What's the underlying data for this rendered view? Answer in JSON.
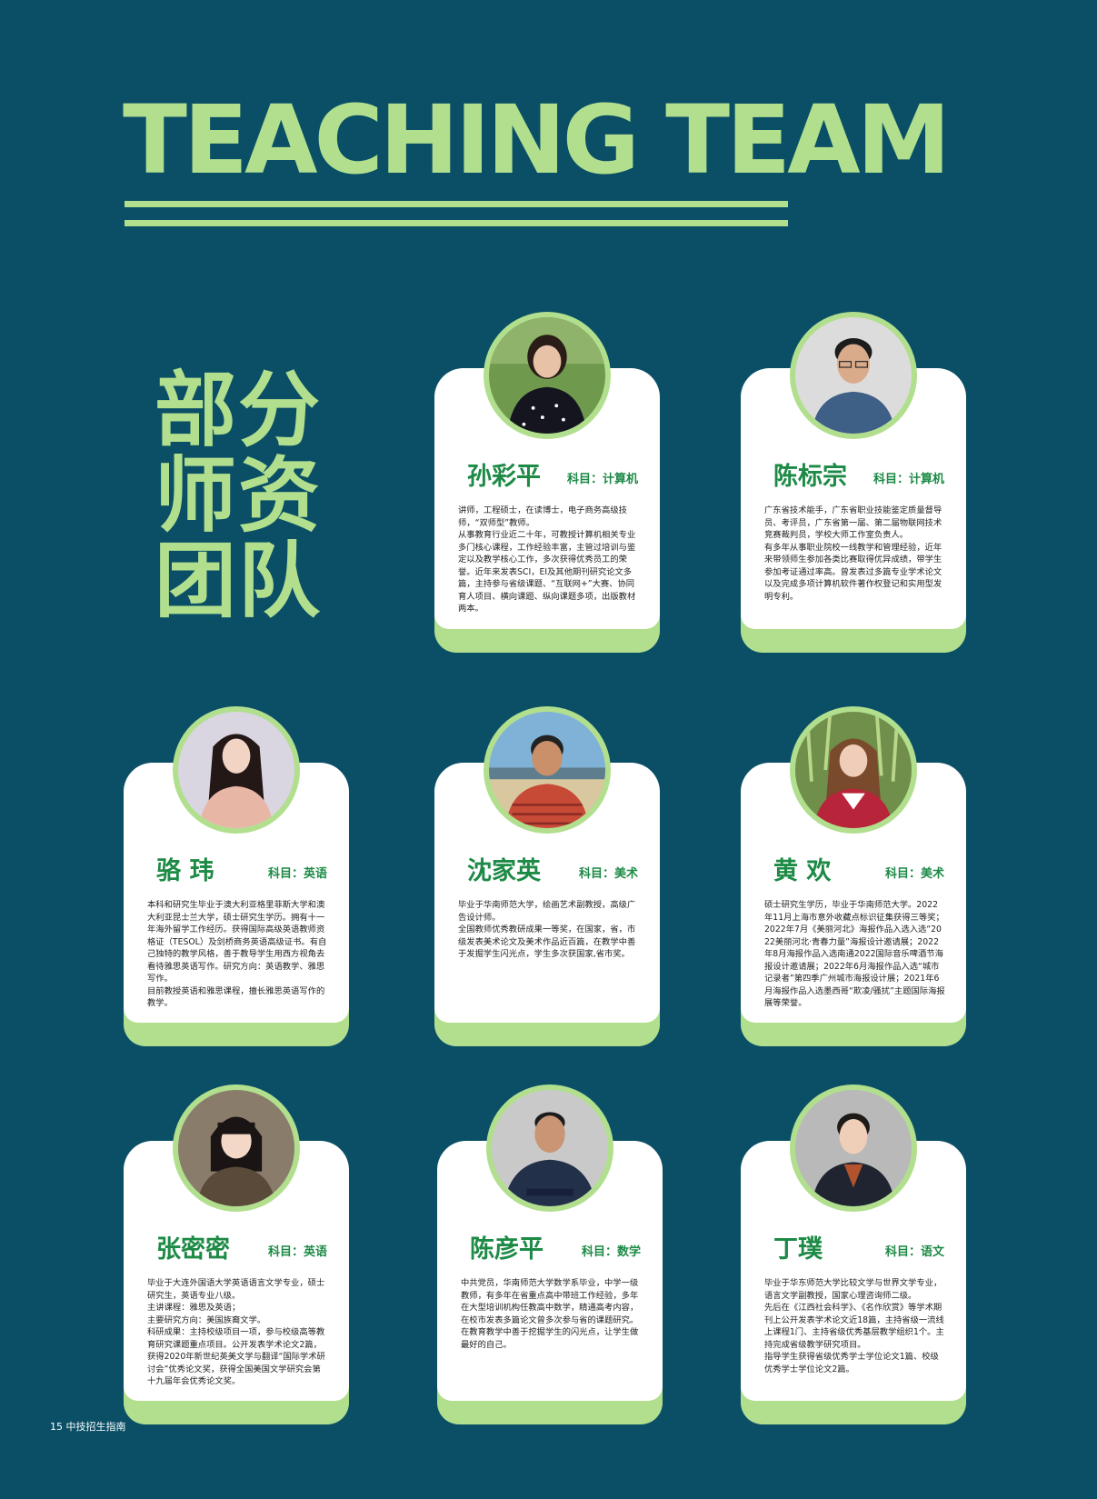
{
  "header": {
    "title": "TEACHING TEAM",
    "subtitle_lines": [
      "部分",
      "师资",
      "团队"
    ]
  },
  "teachers": [
    {
      "name": "孙彩平",
      "subject": "科目：计算机",
      "bio": "讲师，工程硕士，在读博士，电子商务高级技师，“双师型”教师。\n从事教育行业近二十年，可教授计算机相关专业多门核心课程，工作经验丰富，主管过培训与鉴定以及教学核心工作，多次获得优秀员工的荣誉。近年来发表SCI，EI及其他期刊研究论文多篇，主持参与省级课题、“互联网+”大赛、协同育人项目、横向课题、纵向课题多项，出版教材两本。"
    },
    {
      "name": "陈标宗",
      "subject": "科目：计算机",
      "bio": "广东省技术能手，广东省职业技能鉴定质量督导员、考评员，广东省第一届、第二届物联网技术竞赛裁判员，学校大师工作室负责人。\n有多年从事职业院校一线教学和管理经验，近年来带领师生参加各类比赛取得优异成绩，带学生参加考证通过率高。曾发表过多篇专业学术论文以及完成多项计算机软件著作权登记和实用型发明专利。"
    },
    {
      "name": "骆 玮",
      "subject": "科目：英语",
      "bio": "本科和研究生毕业于澳大利亚格里菲斯大学和澳大利亚昆士兰大学，硕士研究生学历。拥有十一年海外留学工作经历。获得国际高级英语教师资格证（TESOL）及剑桥商务英语高级证书。有自己独特的教学风格，善于教导学生用西方视角去看待雅思英语写作。研究方向：英语教学、雅思写作。\n目前教授英语和雅思课程，擅长雅思英语写作的教学。"
    },
    {
      "name": "沈家英",
      "subject": "科目：美术",
      "bio": "毕业于华南师范大学，绘画艺术副教授，高级广告设计师。\n全国教师优秀教研成果一等奖，在国家，省，市级发表美术论文及美术作品近百篇，在教学中善于发掘学生闪光点，学生多次获国家,省市奖。"
    },
    {
      "name": "黄 欢",
      "subject": "科目：美术",
      "bio": "硕士研究生学历，毕业于华南师范大学。2022年11月上海市意外收藏点标识征集获得三等奖；2022年7月《美丽河北》海报作品入选入选“2022美丽河北·青春力量”海报设计邀请展；2022年8月海报作品入选南通2022国际音乐啤酒节海报设计邀请展；2022年6月海报作品入选“城市记录者”第四季广州城市海报设计展；2021年6月海报作品入选墨西哥“欺凌/骚扰”主题国际海报展等荣誉。"
    },
    {
      "name": "张密密",
      "subject": "科目：英语",
      "bio": "毕业于大连外国语大学英语语言文学专业，硕士研究生，英语专业八级。\n主讲课程：雅思及英语；\n主要研究方向：美国族裔文学。\n科研成果：主持校级项目一项，参与校级高等教育研究课题重点项目。公开发表学术论文2篇，获得2020年新世纪英美文学与翻译“国际学术研讨会”优秀论文奖，获得全国美国文学研究会第十九届年会优秀论文奖。"
    },
    {
      "name": "陈彦平",
      "subject": "科目：数学",
      "bio": "中共党员，华南师范大学数学系毕业，中学一级教师，有多年在省重点高中带班工作经验，多年在大型培训机构任教高中数学，精通高考内容，在校市发表多篇论文曾多次参与省的课题研究。\n在教育教学中善于挖掘学生的闪光点，让学生做最好的自己。"
    },
    {
      "name": "丁璞",
      "subject": "科目：语文",
      "bio": "毕业于华东师范大学比较文学与世界文学专业，语言文学副教授，国家心理咨询师二级。\n先后在《江西社会科学》、《名作欣赏》等学术期刊上公开发表学术论文近18篇，主持省级一流线上课程1门、主持省级优秀基层教学组织1个。主持完成省级教学研究项目。\n指导学生获得省级优秀学士学位论文1篇、校级优秀学士学位论文2篇。"
    }
  ],
  "footer": {
    "text": "15  中技招生指南"
  },
  "colors": {
    "background": "#0a4f66",
    "accent": "#b1df8e",
    "name": "#1d8a46"
  }
}
